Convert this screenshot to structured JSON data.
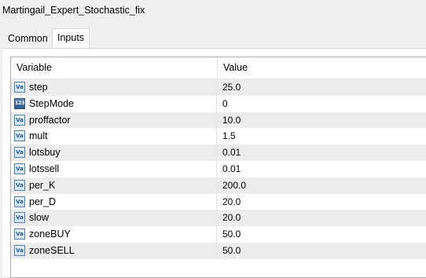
{
  "window": {
    "title": "Martingail_Expert_Stochastic_fix"
  },
  "tabs": [
    {
      "label": "Common",
      "active": false
    },
    {
      "label": "Inputs",
      "active": true
    }
  ],
  "table": {
    "headers": {
      "variable": "Variable",
      "value": "Value"
    },
    "rows": [
      {
        "name": "step",
        "value": "25.0",
        "icon": "double-type-icon"
      },
      {
        "name": "StepMode",
        "value": "0",
        "icon": "integer-type-icon"
      },
      {
        "name": "proffactor",
        "value": "10.0",
        "icon": "double-type-icon"
      },
      {
        "name": "mult",
        "value": "1.5",
        "icon": "double-type-icon"
      },
      {
        "name": "lotsbuy",
        "value": "0.01",
        "icon": "double-type-icon"
      },
      {
        "name": "lotssell",
        "value": "0.01",
        "icon": "double-type-icon"
      },
      {
        "name": "per_K",
        "value": "200.0",
        "icon": "double-type-icon"
      },
      {
        "name": "per_D",
        "value": "20.0",
        "icon": "double-type-icon"
      },
      {
        "name": "slow",
        "value": "20.0",
        "icon": "double-type-icon"
      },
      {
        "name": "zoneBUY",
        "value": "50.0",
        "icon": "double-type-icon"
      },
      {
        "name": "zoneSELL",
        "value": "50.0",
        "icon": "double-type-icon"
      }
    ]
  }
}
